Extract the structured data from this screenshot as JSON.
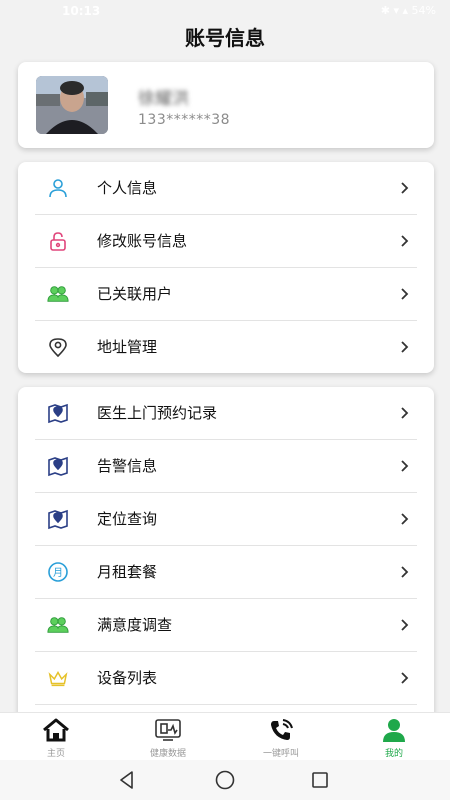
{
  "status_bar": {
    "time": "10:13",
    "icons": "✱ ▾ ▴ 54%"
  },
  "page": {
    "title": "账号信息"
  },
  "profile": {
    "name": "徐耀洪",
    "phone": "133******38"
  },
  "menu_groups": [
    {
      "items": [
        {
          "icon": "person-icon",
          "label": "个人信息"
        },
        {
          "icon": "lock-icon",
          "label": "修改账号信息"
        },
        {
          "icon": "users-icon",
          "label": "已关联用户"
        },
        {
          "icon": "location-pin-icon",
          "label": "地址管理"
        }
      ]
    },
    {
      "items": [
        {
          "icon": "map-pin-icon",
          "label": "医生上门预约记录"
        },
        {
          "icon": "map-pin-icon",
          "label": "告警信息"
        },
        {
          "icon": "map-pin-icon",
          "label": "定位查询"
        },
        {
          "icon": "month-icon",
          "label": "月租套餐",
          "glyph": "月"
        },
        {
          "icon": "users-icon",
          "label": "满意度调查"
        },
        {
          "icon": "crown-icon",
          "label": "设备列表"
        }
      ]
    }
  ],
  "tab_bar": {
    "tabs": [
      {
        "icon": "home-icon",
        "label": "主页"
      },
      {
        "icon": "health-data-icon",
        "label": "健康数据"
      },
      {
        "icon": "phone-call-icon",
        "label": "一键呼叫"
      },
      {
        "icon": "profile-icon",
        "label": "我的",
        "active": true
      }
    ]
  },
  "colors": {
    "accent_green": "#1fa84a",
    "icon_blue": "#2a9fd8",
    "icon_pink": "#e0457b",
    "icon_navy": "#2b3f86",
    "icon_yellow": "#e6c22a"
  }
}
